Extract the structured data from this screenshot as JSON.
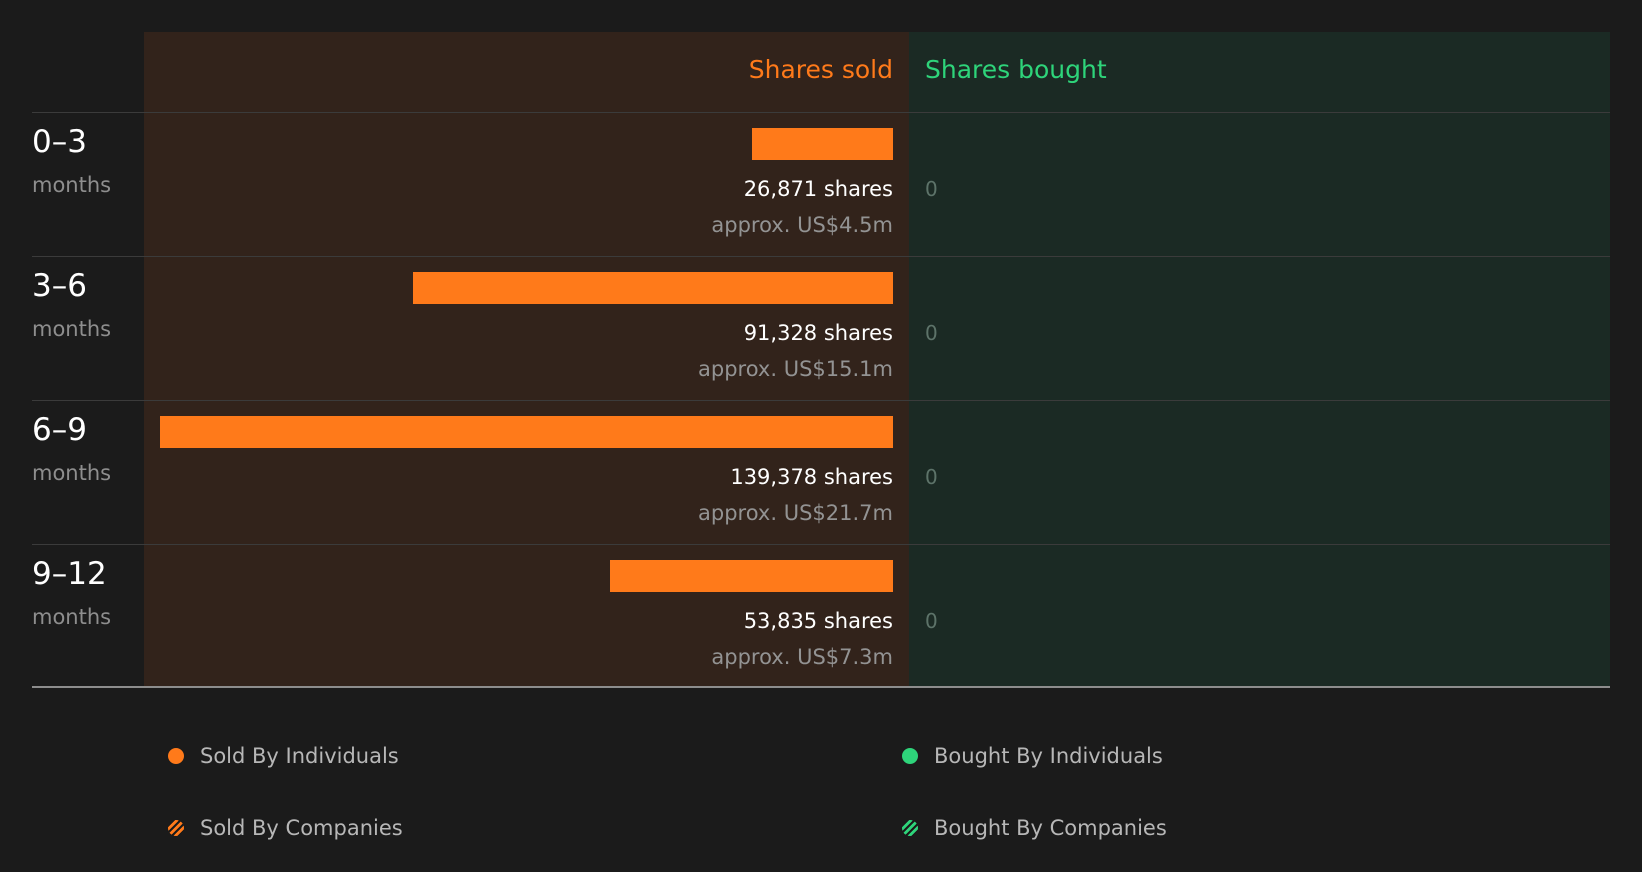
{
  "colors": {
    "sold": "#ff7a1a",
    "bought": "#2ed47a",
    "sold_panel": "#32231b",
    "bought_panel": "#1b2a24",
    "background": "#1b1b1b"
  },
  "headers": {
    "sold": "Shares sold",
    "bought": "Shares bought"
  },
  "chart_data": {
    "type": "bar",
    "orientation": "horizontal",
    "categories": [
      "0–3",
      "3–6",
      "6–9",
      "9–12"
    ],
    "category_unit": "months",
    "series": [
      {
        "name": "Shares sold",
        "values": [
          26871,
          91328,
          139378,
          53835
        ]
      },
      {
        "name": "Shares bought",
        "values": [
          0,
          0,
          0,
          0
        ]
      }
    ],
    "xlim": [
      0,
      139378
    ],
    "rows": [
      {
        "period": "0–3",
        "unit": "months",
        "sold_shares_label": "26,871 shares",
        "sold_value_label": "approx. US$4.5m",
        "bought_label": "0"
      },
      {
        "period": "3–6",
        "unit": "months",
        "sold_shares_label": "91,328 shares",
        "sold_value_label": "approx. US$15.1m",
        "bought_label": "0"
      },
      {
        "period": "6–9",
        "unit": "months",
        "sold_shares_label": "139,378 shares",
        "sold_value_label": "approx. US$21.7m",
        "bought_label": "0"
      },
      {
        "period": "9–12",
        "unit": "months",
        "sold_shares_label": "53,835 shares",
        "sold_value_label": "approx. US$7.3m",
        "bought_label": "0"
      }
    ],
    "legend": [
      {
        "label": "Sold By Individuals",
        "marker": "solid-dot",
        "color": "#ff7a1a"
      },
      {
        "label": "Bought By Individuals",
        "marker": "solid-dot",
        "color": "#2ed47a"
      },
      {
        "label": "Sold By Companies",
        "marker": "striped-dot",
        "color": "#ff7a1a"
      },
      {
        "label": "Bought By Companies",
        "marker": "striped-dot",
        "color": "#2ed47a"
      }
    ],
    "grid": false,
    "legend_position": "bottom"
  }
}
